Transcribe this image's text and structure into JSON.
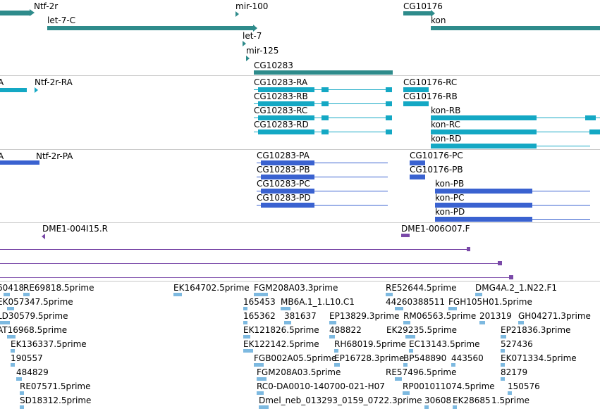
{
  "colors": {
    "gene": "#2e8b8b",
    "mrna": "#14a8c4",
    "cds": "#3a62d0",
    "cdna": "#7a49a8",
    "est": "#7db9e0"
  },
  "tracks": {
    "genes": {
      "labels": [
        "Ntf-2r",
        "let-7-C",
        "mir-100",
        "let-7",
        "mir-125",
        "CG10283",
        "CG10176",
        "kon"
      ]
    },
    "transcripts": {
      "labels": [
        "A",
        "Ntf-2r-RA",
        "CG10283-RA",
        "CG10283-RB",
        "CG10283-RC",
        "CG10283-RD",
        "CG10176-RC",
        "CG10176-RB",
        "kon-RB",
        "kon-RC",
        "kon-RD"
      ]
    },
    "proteins": {
      "labels": [
        "A",
        "Ntf-2r-PA",
        "CG10283-PA",
        "CG10283-PB",
        "CG10283-PC",
        "CG10283-PD",
        "CG10176-PC",
        "CG10176-PB",
        "kon-PB",
        "kon-PC",
        "kon-PD"
      ]
    },
    "cdna": {
      "labels": [
        "DME1-004I15.R",
        "DME1-006O07.F"
      ]
    },
    "ests": {
      "labels": [
        "60418",
        "RE69818.5prime",
        "EK164702.5prime",
        "FGM208A03.3prime",
        "RE52644.5prime",
        "DMG4A.2_1.N22.F1",
        "EK057347.5prime",
        "165453",
        "MB6A.1_1.L10.C1",
        "44260388511",
        "FGH105H01.5prime",
        "LD30579.5prime",
        "165362",
        "381637",
        "EP13829.3prime",
        "RM06563.5prime",
        "201319",
        "GH04271.3prime",
        "AT16968.5prime",
        "EK121826.5prime",
        "488822",
        "EK29235.5prime",
        "EP21836.3prime",
        "EK136337.5prime",
        "EK122142.5prime",
        "RH68019.5prime",
        "EC13143.5prime",
        "527436",
        "190557",
        "FGB002A05.5prime",
        "EP16728.3prime",
        "BP548890",
        "443560",
        "EK071334.5prime",
        "484829",
        "FGM208A03.5prime",
        "RE57496.5prime",
        "82179",
        "RE07571.5prime",
        "RC0-DA0010-140700-021-H07",
        "RP001011074.5prime",
        "150576",
        "SD18312.5prime",
        "Dmel_neb_013293_0159_0722.3prime",
        "30608",
        "EK28685",
        "1.5prime"
      ]
    }
  }
}
